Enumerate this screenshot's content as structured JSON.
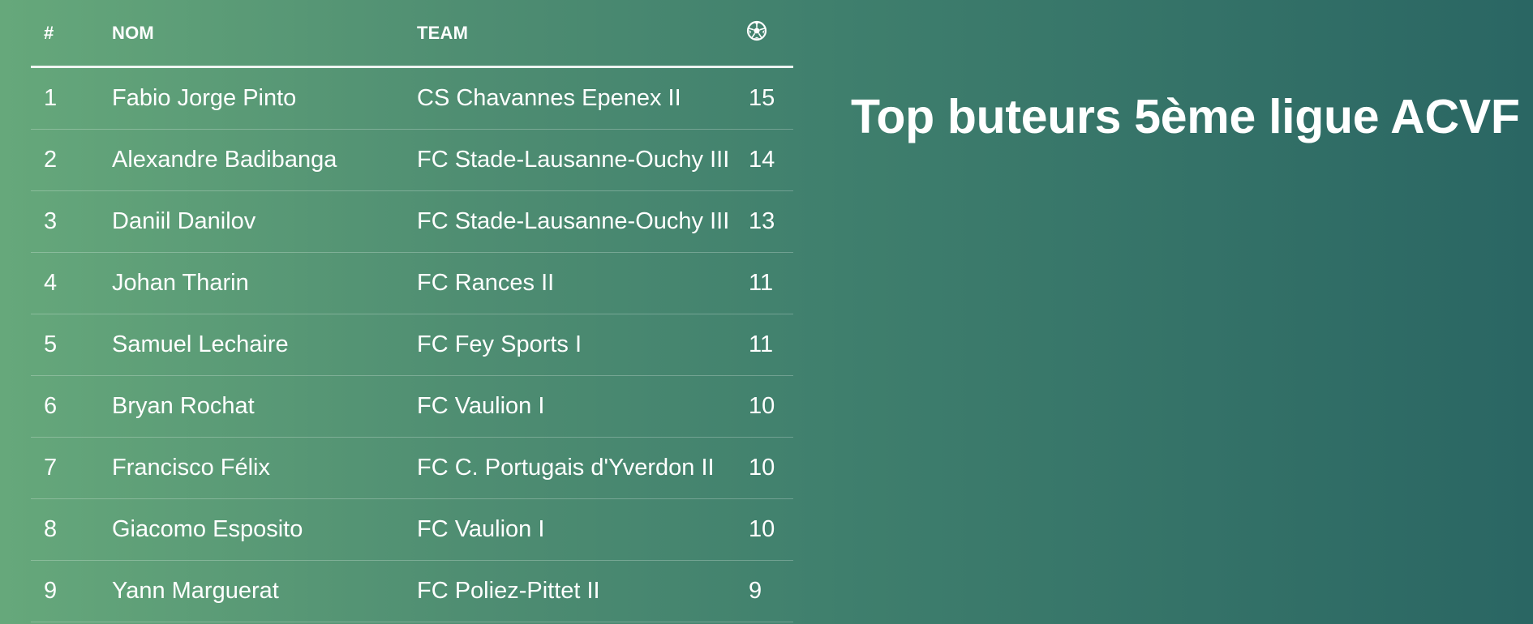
{
  "title": "Top buteurs 5ème ligue ACVF",
  "table": {
    "headers": {
      "rank": "#",
      "name": "NOM",
      "team": "TEAM",
      "goals_icon": "soccer-ball-icon"
    },
    "rows": [
      {
        "rank": "1",
        "name": "Fabio Jorge Pinto",
        "team": "CS Chavannes Epenex II",
        "goals": "15"
      },
      {
        "rank": "2",
        "name": "Alexandre Badibanga",
        "team": "FC Stade-Lausanne-Ouchy III",
        "goals": "14"
      },
      {
        "rank": "3",
        "name": "Daniil Danilov",
        "team": "FC Stade-Lausanne-Ouchy III",
        "goals": "13"
      },
      {
        "rank": "4",
        "name": "Johan Tharin",
        "team": "FC Rances II",
        "goals": "11"
      },
      {
        "rank": "5",
        "name": "Samuel Lechaire",
        "team": "FC Fey Sports I",
        "goals": "11"
      },
      {
        "rank": "6",
        "name": "Bryan Rochat",
        "team": "FC Vaulion I",
        "goals": "10"
      },
      {
        "rank": "7",
        "name": "Francisco Félix",
        "team": "FC C. Portugais d'Yverdon II",
        "goals": "10"
      },
      {
        "rank": "8",
        "name": "Giacomo Esposito",
        "team": "FC Vaulion I",
        "goals": "10"
      },
      {
        "rank": "9",
        "name": "Yann Marguerat",
        "team": "FC Poliez-Pittet II",
        "goals": "9"
      }
    ]
  },
  "colors": {
    "gradient_left": "#66a87b",
    "gradient_right": "#2a6663",
    "text": "#ffffff"
  }
}
